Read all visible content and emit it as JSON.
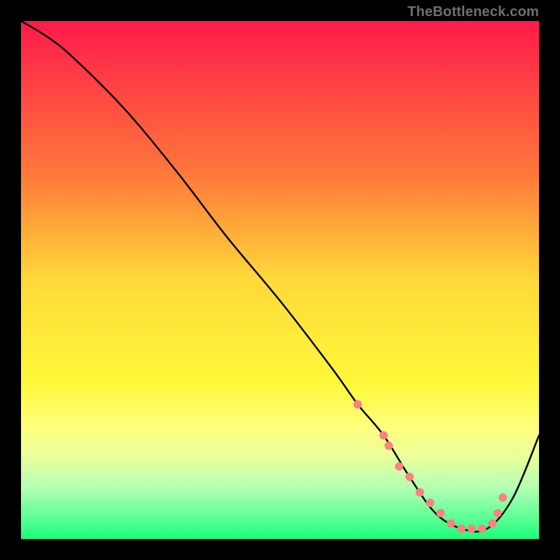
{
  "attribution": "TheBottleneck.com",
  "chart_data": {
    "type": "line",
    "title": "",
    "xlabel": "",
    "ylabel": "",
    "xlim": [
      0,
      100
    ],
    "ylim": [
      0,
      100
    ],
    "gradient_stops": [
      {
        "offset": 0.0,
        "color": "#ff1a4a"
      },
      {
        "offset": 0.3,
        "color": "#ff7a3a"
      },
      {
        "offset": 0.5,
        "color": "#ffd93a"
      },
      {
        "offset": 0.7,
        "color": "#fff83a"
      },
      {
        "offset": 0.78,
        "color": "#ffff7a"
      },
      {
        "offset": 0.84,
        "color": "#eaff9a"
      },
      {
        "offset": 0.9,
        "color": "#b4ffb4"
      },
      {
        "offset": 0.95,
        "color": "#6aff9a"
      },
      {
        "offset": 1.0,
        "color": "#1aff7a"
      }
    ],
    "series": [
      {
        "name": "bottleneck-curve",
        "x": [
          0,
          5,
          10,
          20,
          30,
          40,
          50,
          60,
          65,
          70,
          75,
          80,
          85,
          90,
          95,
          100
        ],
        "y": [
          100,
          97,
          93,
          83,
          71,
          58,
          46,
          33,
          26,
          20,
          12,
          5,
          2,
          2,
          8,
          20
        ]
      }
    ],
    "markers": {
      "name": "bottleneck-markers",
      "x": [
        65,
        70,
        71,
        73,
        75,
        77,
        79,
        81,
        83,
        85,
        87,
        89,
        91,
        92,
        93
      ],
      "y": [
        26,
        20,
        18,
        14,
        12,
        9,
        7,
        5,
        3,
        2,
        2,
        2,
        3,
        5,
        8
      ],
      "color": "#ff8080",
      "radius": 6
    }
  }
}
